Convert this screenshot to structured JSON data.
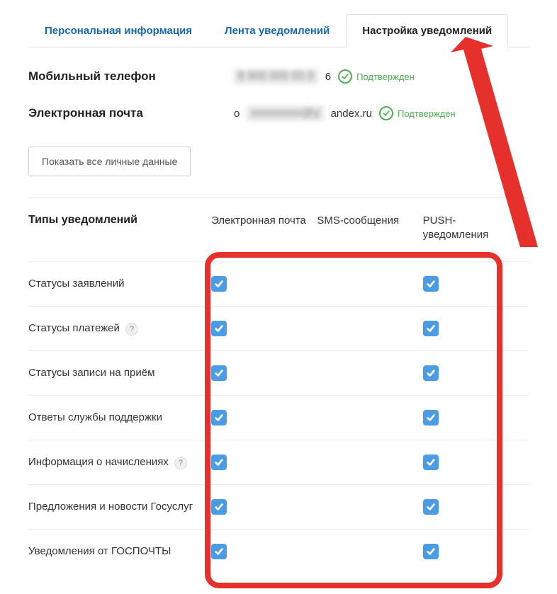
{
  "tabs": {
    "personal": "Персональная информация",
    "feed": "Лента уведомлений",
    "settings": "Настройка уведомлений"
  },
  "fields": {
    "phone_label": "Мобильный телефон",
    "phone_suffix": "6",
    "email_label": "Электронная почта",
    "email_prefix": "o",
    "email_suffix": "andex.ru",
    "verified": "Подтвержден"
  },
  "show_all": "Показать все личные данные",
  "headers": {
    "types": "Типы уведомлений",
    "email": "Электронная почта",
    "sms": "SMS-сообщения",
    "push": "PUSH-уведомления"
  },
  "rows": [
    {
      "label": "Статусы заявлений",
      "help": false,
      "email": true,
      "sms": false,
      "push": true
    },
    {
      "label": "Статусы платежей",
      "help": true,
      "email": true,
      "sms": false,
      "push": true
    },
    {
      "label": "Статусы записи на приём",
      "help": false,
      "email": true,
      "sms": false,
      "push": true
    },
    {
      "label": "Ответы службы поддержки",
      "help": false,
      "email": true,
      "sms": false,
      "push": true
    },
    {
      "label": "Информация о начислениях",
      "help": true,
      "email": true,
      "sms": false,
      "push": true
    },
    {
      "label": "Предложения и новости Госуслуг",
      "help": false,
      "email": true,
      "sms": false,
      "push": true
    },
    {
      "label": "Уведомления от ГОСПОЧТЫ",
      "help": false,
      "email": true,
      "sms": false,
      "push": true
    }
  ]
}
